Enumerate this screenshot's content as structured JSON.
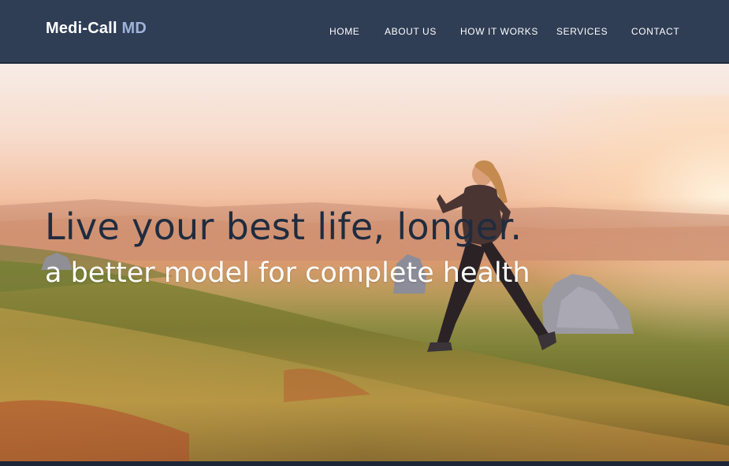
{
  "header": {
    "logo_main": "Medi-Call",
    "logo_accent": "MD"
  },
  "nav": {
    "items": [
      {
        "label": "HOME"
      },
      {
        "label": "ABOUT US"
      },
      {
        "label": "HOW IT WORKS"
      },
      {
        "label": "SERVICES"
      },
      {
        "label": "CONTACT"
      }
    ]
  },
  "hero": {
    "headline": "Live your best life, longer.",
    "subheadline": "a better model for complete health"
  },
  "colors": {
    "header_bg": "#2f3d55",
    "logo_accent": "#9fb3d9",
    "headline": "#1f2c3f"
  }
}
